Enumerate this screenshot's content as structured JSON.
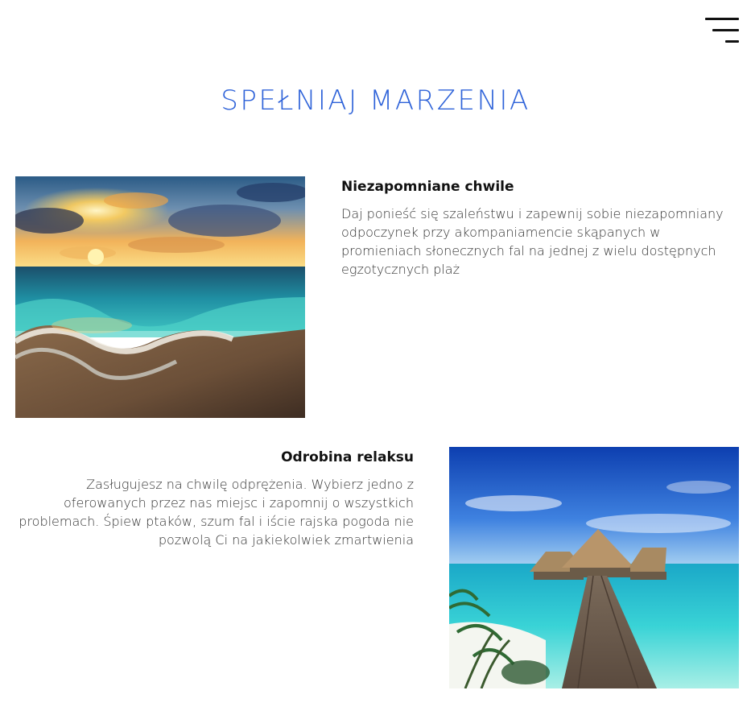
{
  "header": {
    "menu_icon": "hamburger-menu-icon"
  },
  "page": {
    "title": "SPEŁNIAJ MARZENIA"
  },
  "features": [
    {
      "title": "Niezapomniane chwile",
      "text": "Daj ponieść się szaleństwu i zapewnij sobie niezapomniany odpoczynek przy akompaniamencie skąpanych w promieniach słonecznych fal na jednej z wielu dostępnych egzotycznych plaż",
      "image_subject": "sunset-beach-waves"
    },
    {
      "title": "Odrobina relaksu",
      "text": "Zasługujesz na chwilę odprężenia. Wybierz jedno z oferowanych przez nas miejsc i zapomnij o wszystkich problemach. Śpiew ptaków, szum fal i iście rajska pogoda nie pozwolą Ci na jakiekolwiek zmartwienia",
      "image_subject": "overwater-bungalow-pier"
    }
  ],
  "colors": {
    "accent": "#2f63d9",
    "text": "#333333",
    "heading": "#111111"
  }
}
